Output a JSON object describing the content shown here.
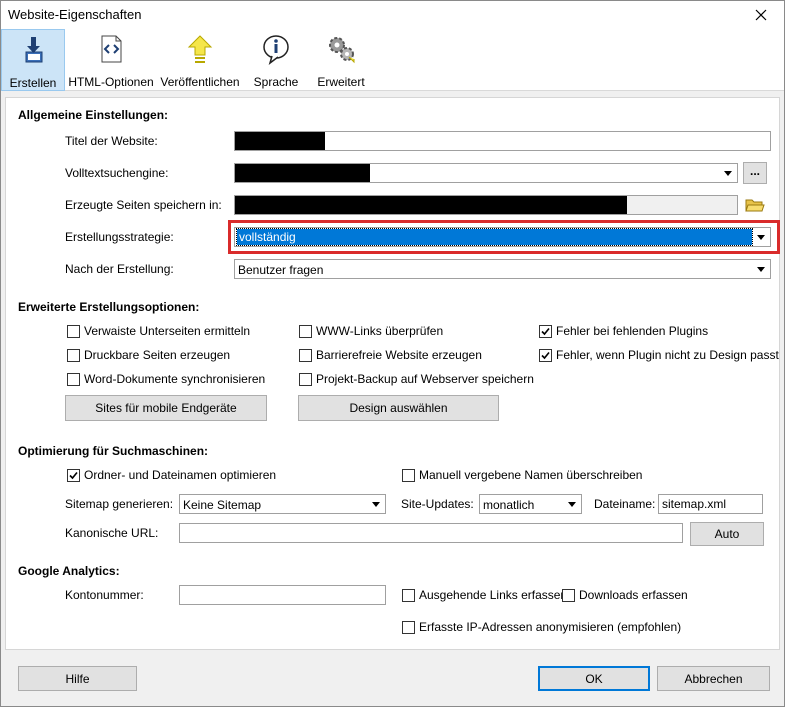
{
  "window": {
    "title": "Website-Eigenschaften"
  },
  "toolbar": {
    "items": [
      {
        "label": "Erstellen",
        "icon": "download-page-icon",
        "active": true
      },
      {
        "label": "HTML-Optionen",
        "icon": "code-document-icon",
        "active": false
      },
      {
        "label": "Veröffentlichen",
        "icon": "upload-arrow-icon",
        "active": false
      },
      {
        "label": "Sprache",
        "icon": "info-speech-bubble-icon",
        "active": false
      },
      {
        "label": "Erweitert",
        "icon": "gears-icon",
        "active": false
      }
    ]
  },
  "general": {
    "section_title": "Allgemeine Einstellungen:",
    "site_title_label": "Titel der Website:",
    "search_engine_label": "Volltextsuchengine:",
    "save_path_label": "Erzeugte Seiten speichern in:",
    "browse_label": "...",
    "strategy_label": "Erstellungsstrategie:",
    "strategy_value": "vollständig",
    "after_label": "Nach der Erstellung:",
    "after_value": "Benutzer fragen"
  },
  "extended": {
    "section_title": "Erweiterte Erstellungsoptionen:",
    "options": [
      {
        "label": "Verwaiste Unterseiten ermitteln",
        "checked": false
      },
      {
        "label": "Druckbare Seiten erzeugen",
        "checked": false
      },
      {
        "label": "Word-Dokumente synchronisieren",
        "checked": false
      },
      {
        "label": "WWW-Links überprüfen",
        "checked": false
      },
      {
        "label": "Barrierefreie Website erzeugen",
        "checked": false
      },
      {
        "label": "Projekt-Backup auf Webserver speichern",
        "checked": false
      },
      {
        "label": "Fehler bei fehlenden Plugins",
        "checked": true
      },
      {
        "label": "Fehler, wenn Plugin nicht zu Design passt",
        "checked": true
      }
    ],
    "mobile_button": "Sites für mobile Endgeräte",
    "design_button": "Design auswählen"
  },
  "seo": {
    "section_title": "Optimierung für Suchmaschinen:",
    "optimize_names_label": "Ordner- und Dateinamen optimieren",
    "optimize_names_checked": true,
    "override_names_label": "Manuell vergebene Namen überschreiben",
    "override_names_checked": false,
    "sitemap_label": "Sitemap generieren:",
    "sitemap_value": "Keine Sitemap",
    "updates_label": "Site-Updates:",
    "updates_value": "monatlich",
    "filename_label": "Dateiname:",
    "filename_value": "sitemap.xml",
    "canonical_label": "Kanonische URL:",
    "canonical_value": "",
    "auto_button": "Auto"
  },
  "analytics": {
    "section_title": "Google Analytics:",
    "account_label": "Kontonummer:",
    "account_value": "",
    "outgoing_label": "Ausgehende Links erfassen",
    "downloads_label": "Downloads erfassen",
    "anonymize_label": "Erfasste IP-Adressen anonymisieren (empfohlen)"
  },
  "footer": {
    "help_button": "Hilfe",
    "ok_button": "OK",
    "cancel_button": "Abbrechen"
  },
  "colors": {
    "selection": "#0078d7",
    "highlight_border": "#d92b2b",
    "active_tab": "#cce4f7"
  }
}
